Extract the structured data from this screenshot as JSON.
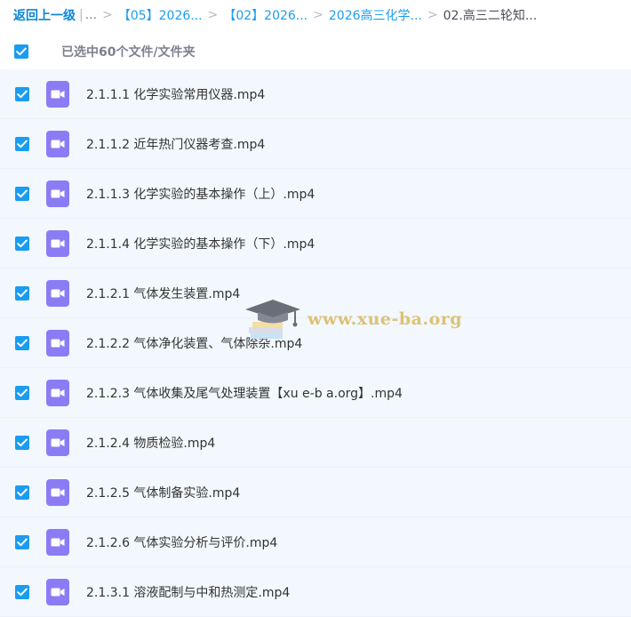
{
  "breadcrumb": {
    "back_label": "返回上一级",
    "pipe": "|",
    "ellipsis": "...",
    "separator": ">",
    "items": [
      "【05】2026...",
      "【02】2026...",
      "2026高三化学..."
    ],
    "current": "02.高三二轮知..."
  },
  "selection": {
    "label": "已选中60个文件/文件夹",
    "checked": true
  },
  "files": [
    {
      "name": "2.1.1.1 化学实验常用仪器.mp4",
      "icon": "video-file-icon",
      "checked": true
    },
    {
      "name": "2.1.1.2 近年热门仪器考查.mp4",
      "icon": "video-file-icon",
      "checked": true
    },
    {
      "name": "2.1.1.3 化学实验的基本操作（上）.mp4",
      "icon": "video-file-icon",
      "checked": true
    },
    {
      "name": "2.1.1.4 化学实验的基本操作（下）.mp4",
      "icon": "video-file-icon",
      "checked": true
    },
    {
      "name": "2.1.2.1 气体发生装置.mp4",
      "icon": "video-file-icon",
      "checked": true
    },
    {
      "name": "2.1.2.2 气体净化装置、气体除杂.mp4",
      "icon": "video-file-icon",
      "checked": true
    },
    {
      "name": "2.1.2.3 气体收集及尾气处理装置【xu e-b a.org】.mp4",
      "icon": "video-file-icon",
      "checked": true
    },
    {
      "name": "2.1.2.4 物质检验.mp4",
      "icon": "video-file-icon",
      "checked": true
    },
    {
      "name": "2.1.2.5 气体制备实验.mp4",
      "icon": "video-file-icon",
      "checked": true
    },
    {
      "name": "2.1.2.6 气体实验分析与评价.mp4",
      "icon": "video-file-icon",
      "checked": true
    },
    {
      "name": "2.1.3.1 溶液配制与中和热测定.mp4",
      "icon": "video-file-icon",
      "checked": true
    }
  ],
  "watermark": {
    "text": "www.xue-ba.org",
    "icon": "graduation-cap-icon"
  },
  "colors": {
    "accent": "#1a9cf0",
    "back_link": "#0a86d8",
    "row_background": "#f2f8fe",
    "video_icon": "#8b7cf6",
    "watermark": "#d6b046"
  }
}
